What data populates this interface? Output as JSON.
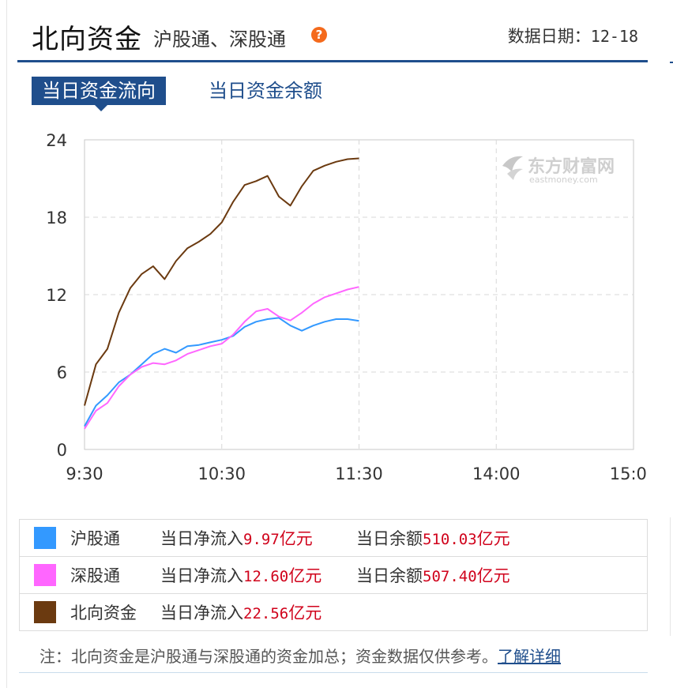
{
  "header": {
    "title": "北向资金",
    "subtitle": "沪股通、深股通",
    "date_label": "数据日期：",
    "date_value": "12-18"
  },
  "tabs": [
    {
      "label": "当日资金流向",
      "active": true
    },
    {
      "label": "当日资金余额",
      "active": false
    }
  ],
  "watermark": {
    "cn": "东方财富网",
    "en": "eastmoney.com"
  },
  "chart_data": {
    "type": "line",
    "title": "",
    "xlabel": "",
    "ylabel": "",
    "ylim": [
      0,
      24
    ],
    "yticks": [
      0,
      6,
      12,
      18,
      24
    ],
    "xticks": [
      "9:30",
      "10:30",
      "11:30",
      "14:00",
      "15:00"
    ],
    "grid": true,
    "series": [
      {
        "name": "沪股通",
        "color": "#3399ff",
        "points": [
          [
            "9:30",
            1.8
          ],
          [
            "9:35",
            3.4
          ],
          [
            "9:40",
            4.2
          ],
          [
            "9:45",
            5.2
          ],
          [
            "9:50",
            5.8
          ],
          [
            "9:55",
            6.6
          ],
          [
            "10:00",
            7.4
          ],
          [
            "10:05",
            7.8
          ],
          [
            "10:10",
            7.5
          ],
          [
            "10:15",
            8.0
          ],
          [
            "10:20",
            8.1
          ],
          [
            "10:25",
            8.3
          ],
          [
            "10:30",
            8.5
          ],
          [
            "10:35",
            8.8
          ],
          [
            "10:40",
            9.5
          ],
          [
            "10:45",
            9.9
          ],
          [
            "10:50",
            10.1
          ],
          [
            "10:55",
            10.2
          ],
          [
            "11:00",
            9.6
          ],
          [
            "11:05",
            9.2
          ],
          [
            "11:10",
            9.6
          ],
          [
            "11:15",
            9.9
          ],
          [
            "11:20",
            10.1
          ],
          [
            "11:25",
            10.1
          ],
          [
            "11:30",
            9.97
          ]
        ]
      },
      {
        "name": "深股通",
        "color": "#ff66ff",
        "points": [
          [
            "9:30",
            1.6
          ],
          [
            "9:35",
            3.0
          ],
          [
            "9:40",
            3.6
          ],
          [
            "9:45",
            4.9
          ],
          [
            "9:50",
            5.8
          ],
          [
            "9:55",
            6.4
          ],
          [
            "10:00",
            6.7
          ],
          [
            "10:05",
            6.6
          ],
          [
            "10:10",
            6.9
          ],
          [
            "10:15",
            7.4
          ],
          [
            "10:20",
            7.7
          ],
          [
            "10:25",
            8.0
          ],
          [
            "10:30",
            8.2
          ],
          [
            "10:35",
            8.9
          ],
          [
            "10:40",
            9.9
          ],
          [
            "10:45",
            10.7
          ],
          [
            "10:50",
            10.9
          ],
          [
            "10:55",
            10.3
          ],
          [
            "11:00",
            10.0
          ],
          [
            "11:05",
            10.6
          ],
          [
            "11:10",
            11.3
          ],
          [
            "11:15",
            11.8
          ],
          [
            "11:20",
            12.1
          ],
          [
            "11:25",
            12.4
          ],
          [
            "11:30",
            12.6
          ]
        ]
      },
      {
        "name": "北向资金",
        "color": "#6b3a10",
        "points": [
          [
            "9:30",
            3.4
          ],
          [
            "9:35",
            6.6
          ],
          [
            "9:40",
            7.8
          ],
          [
            "9:45",
            10.6
          ],
          [
            "9:50",
            12.5
          ],
          [
            "9:55",
            13.6
          ],
          [
            "10:00",
            14.2
          ],
          [
            "10:05",
            13.2
          ],
          [
            "10:10",
            14.6
          ],
          [
            "10:15",
            15.6
          ],
          [
            "10:20",
            16.1
          ],
          [
            "10:25",
            16.7
          ],
          [
            "10:30",
            17.6
          ],
          [
            "10:35",
            19.2
          ],
          [
            "10:40",
            20.5
          ],
          [
            "10:45",
            20.8
          ],
          [
            "10:50",
            21.2
          ],
          [
            "10:55",
            19.6
          ],
          [
            "11:00",
            18.9
          ],
          [
            "11:05",
            20.4
          ],
          [
            "11:10",
            21.6
          ],
          [
            "11:15",
            22.0
          ],
          [
            "11:20",
            22.3
          ],
          [
            "11:25",
            22.5
          ],
          [
            "11:30",
            22.56
          ]
        ]
      }
    ]
  },
  "legend": [
    {
      "name": "沪股通",
      "color": "#3399ff",
      "flow_label": "当日净流入",
      "flow_value": "9.97",
      "flow_unit": "亿元",
      "balance_label": "当日余额",
      "balance_value": "510.03",
      "balance_unit": "亿元"
    },
    {
      "name": "深股通",
      "color": "#ff66ff",
      "flow_label": "当日净流入",
      "flow_value": "12.60",
      "flow_unit": "亿元",
      "balance_label": "当日余额",
      "balance_value": "507.40",
      "balance_unit": "亿元"
    },
    {
      "name": "北向资金",
      "color": "#6b3a10",
      "flow_label": "当日净流入",
      "flow_value": "22.56",
      "flow_unit": "亿元"
    }
  ],
  "note": {
    "text": "注：北向资金是沪股通与深股通的资金加总；资金数据仅供参考。",
    "link": "了解详细"
  }
}
